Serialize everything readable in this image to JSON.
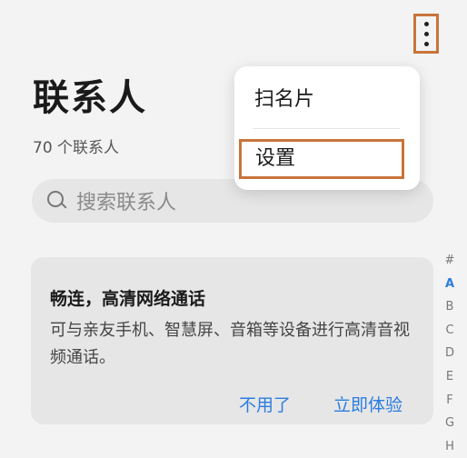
{
  "header": {
    "more_icon": "more-vertical-icon"
  },
  "title": "联系人",
  "contact_count": "70 个联系人",
  "search": {
    "icon": "search-icon",
    "placeholder": "搜索联系人"
  },
  "menu": {
    "items": [
      {
        "label": "扫名片"
      },
      {
        "label": "设置"
      }
    ]
  },
  "promo": {
    "title": "畅连，高清网络通话",
    "description": "可与亲友手机、智慧屏、音箱等设备进行高清音视频通话。",
    "dismiss_label": "不用了",
    "try_label": "立即体验"
  },
  "index": {
    "letters": [
      "#",
      "A",
      "B",
      "C",
      "D",
      "E",
      "F",
      "G",
      "H"
    ],
    "active": "A"
  },
  "colors": {
    "accent": "#2b7de1",
    "highlight_border": "#c9743a",
    "background": "#f3f3f3"
  }
}
